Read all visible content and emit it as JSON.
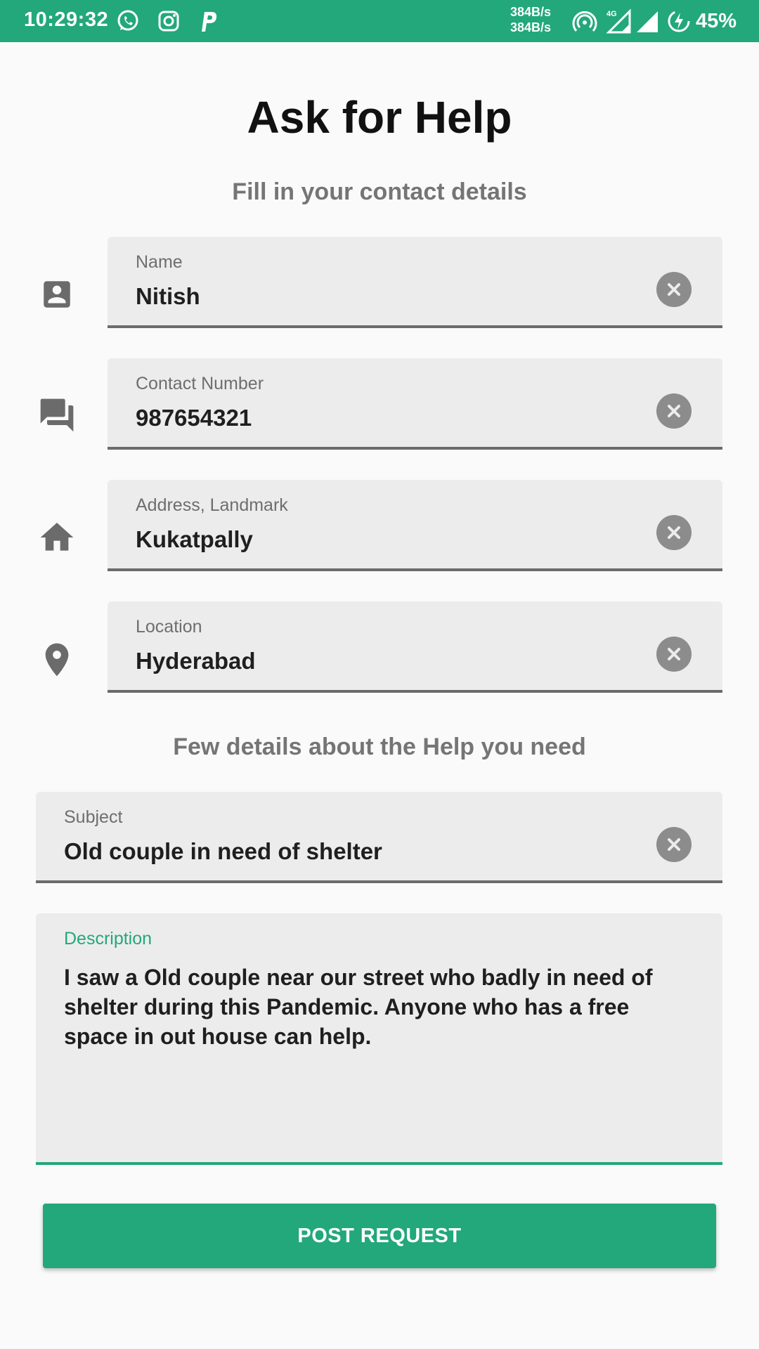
{
  "status_bar": {
    "time": "10:29:32",
    "net_speed_up": "384B/s",
    "net_speed_down": "384B/s",
    "network_type": "4G",
    "battery": "45%",
    "icons": [
      "whatsapp-icon",
      "instagram-icon",
      "paytm-icon",
      "hotspot-icon",
      "signal-4g-icon",
      "signal-icon",
      "battery-charging-icon"
    ]
  },
  "title": "Ask for Help",
  "contact_heading": "Fill in your contact details",
  "fields": {
    "name": {
      "label": "Name",
      "value": "Nitish",
      "icon": "contact-card-icon"
    },
    "contact": {
      "label": "Contact Number",
      "value": "987654321",
      "icon": "chat-icon"
    },
    "address": {
      "label": "Address, Landmark",
      "value": "Kukatpally",
      "icon": "home-icon"
    },
    "location": {
      "label": "Location",
      "value": "Hyderabad",
      "icon": "location-pin-icon"
    }
  },
  "help_heading": "Few details about the Help you need",
  "subject": {
    "label": "Subject",
    "value": "Old couple in need of shelter"
  },
  "description": {
    "label": "Description",
    "value": "I saw a Old couple near our street who badly in need of shelter during this Pandemic. Anyone who has a free space in out house can help."
  },
  "submit_label": "POST REQUEST",
  "colors": {
    "accent": "#22a87b",
    "field_bg": "#ececec",
    "heading_gray": "#757575"
  }
}
